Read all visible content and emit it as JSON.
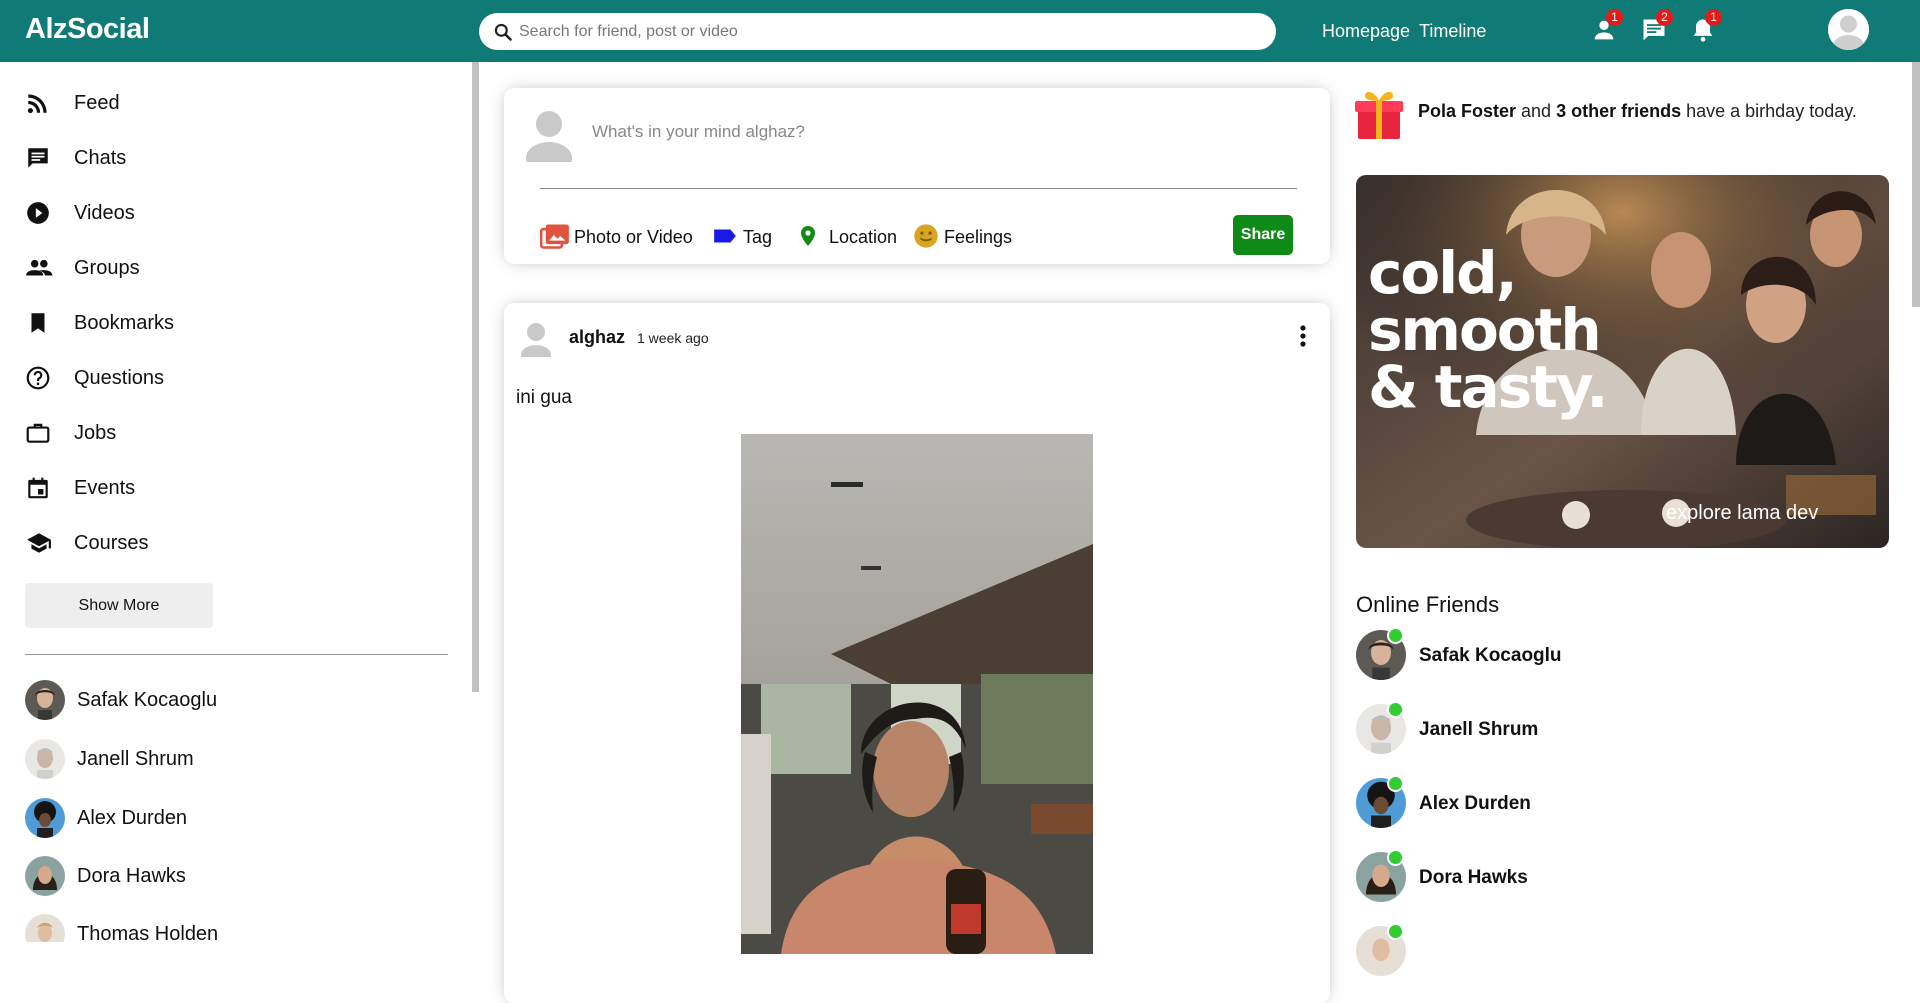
{
  "topbar": {
    "logo": "AlzSocial",
    "search_placeholder": "Search for friend, post or video",
    "links": [
      "Homepage",
      "Timeline"
    ],
    "icons": [
      {
        "name": "person-icon",
        "count": "1"
      },
      {
        "name": "chat-icon",
        "count": "2"
      },
      {
        "name": "notifications-icon",
        "count": "1"
      }
    ]
  },
  "sidebar": {
    "items": [
      {
        "label": "Feed",
        "icon": "rss-feed-icon"
      },
      {
        "label": "Chats",
        "icon": "chat-icon"
      },
      {
        "label": "Videos",
        "icon": "play-circle-icon"
      },
      {
        "label": "Groups",
        "icon": "group-icon"
      },
      {
        "label": "Bookmarks",
        "icon": "bookmark-icon"
      },
      {
        "label": "Questions",
        "icon": "help-outline-icon"
      },
      {
        "label": "Jobs",
        "icon": "work-outline-icon"
      },
      {
        "label": "Events",
        "icon": "event-icon"
      },
      {
        "label": "Courses",
        "icon": "school-icon"
      }
    ],
    "show_more": "Show More",
    "friends": [
      "Safak Kocaoglu",
      "Janell Shrum",
      "Alex Durden",
      "Dora Hawks",
      "Thomas Holden"
    ]
  },
  "share": {
    "placeholder": "What's in your mind alghaz?",
    "options": [
      {
        "label": "Photo or Video",
        "icon": "perm-media-icon",
        "color": "#e2533f"
      },
      {
        "label": "Tag",
        "icon": "label-icon",
        "color": "#1a1ae6"
      },
      {
        "label": "Location",
        "icon": "room-icon",
        "color": "#138a13"
      },
      {
        "label": "Feelings",
        "icon": "emoji-emotions-icon",
        "color": "#d9a520"
      }
    ],
    "button": "Share"
  },
  "post": {
    "user": "alghaz",
    "time": "1 week ago",
    "text": "ini gua"
  },
  "rightbar": {
    "birthday": {
      "name": "Pola Foster",
      "connector": " and ",
      "others": "3 other friends",
      "suffix": " have a birhday today."
    },
    "ad": {
      "headline": [
        "cold,",
        "smooth",
        "& tasty."
      ],
      "footer": "explore lama dev"
    },
    "online_title": "Online Friends",
    "online_friends": [
      "Safak Kocaoglu",
      "Janell Shrum",
      "Alex Durden",
      "Dora Hawks"
    ]
  },
  "colors": {
    "topbar": "#107a76",
    "share_button": "#0f8a17",
    "badge": "#e21b1b",
    "online_dot": "#32cd32"
  }
}
